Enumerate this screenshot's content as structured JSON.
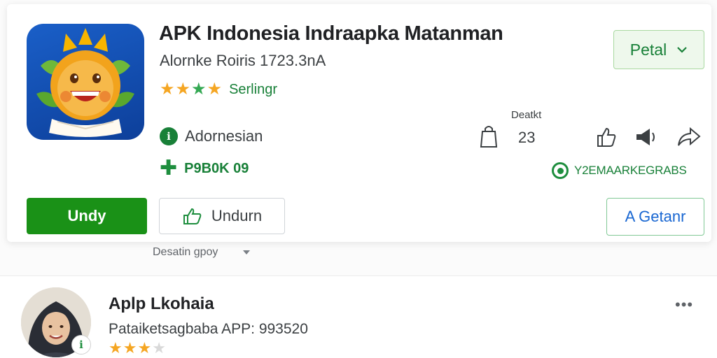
{
  "app": {
    "title": "APK Indonesia Indraapka Matanman",
    "subtitle": "Alornke Roiris 1723.3nA",
    "rating_label": "Serlingr",
    "stars": [
      "gold",
      "gold",
      "green",
      "gold"
    ],
    "language": "Adornesian",
    "price": "P9B0K 09",
    "developer": "Y2EMAARKEGRABS",
    "icon": "app-mascot-icon"
  },
  "buttons": {
    "install": "Undy",
    "uninstall": "Undurn",
    "petal": "Petal",
    "getanr": "A Getanr"
  },
  "stats": {
    "label": "Deatkt",
    "value": "23"
  },
  "description": {
    "label": "Desatin gpoy"
  },
  "list_item": {
    "title": "Aplp Lkohaia",
    "subtitle": "Pataiketsagbaba APP: 993520",
    "stars": [
      "gold",
      "gold",
      "gold",
      "empty"
    ],
    "more": "•••",
    "badge": "ℹ"
  },
  "colors": {
    "accent_green": "#1a9117",
    "link_green": "#188038",
    "star_gold": "#f5a623",
    "blue": "#1967d2"
  }
}
